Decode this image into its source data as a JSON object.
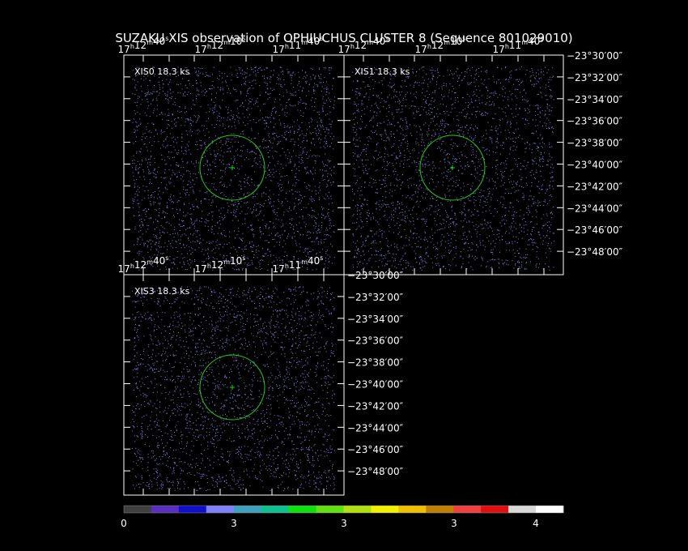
{
  "title": "SUZAKU XIS observation of OPHIUCHUS CLUSTER 8  (Sequence 801029010)",
  "colors": {
    "background": "#000000",
    "frame": "#ffffff",
    "region": "#22cc22",
    "events": "#8a88ee"
  },
  "panels": [
    {
      "id": "xis0",
      "label": "XIS0 18.3 ks",
      "ra_ticks": [
        {
          "h": "17",
          "m": "12",
          "s": "40"
        },
        {
          "h": "17",
          "m": "12",
          "s": "10"
        },
        {
          "h": "17",
          "m": "11",
          "s": "40"
        }
      ],
      "dec_ticks": []
    },
    {
      "id": "xis1",
      "label": "XIS1 18.3 ks",
      "ra_ticks": [
        {
          "h": "17",
          "m": "12",
          "s": "40"
        },
        {
          "h": "17",
          "m": "12",
          "s": "10"
        },
        {
          "h": "17",
          "m": "11",
          "s": "40"
        }
      ],
      "dec_ticks": [
        "−23°30′00″",
        "−23°32′00″",
        "−23°34′00″",
        "−23°36′00″",
        "−23°38′00″",
        "−23°40′00″",
        "−23°42′00″",
        "−23°44′00″",
        "−23°46′00″",
        "−23°48′00″"
      ]
    },
    {
      "id": "xis3",
      "label": "XIS3 18.3 ks",
      "ra_ticks": [
        {
          "h": "17",
          "m": "12",
          "s": "40"
        },
        {
          "h": "17",
          "m": "12",
          "s": "10"
        },
        {
          "h": "17",
          "m": "11",
          "s": "40"
        }
      ],
      "dec_ticks": [
        "−23°30′00″",
        "−23°32′00″",
        "−23°34′00″",
        "−23°36′00″",
        "−23°38′00″",
        "−23°40′00″",
        "−23°42′00″",
        "−23°44′00″",
        "−23°46′00″",
        "−23°48′00″"
      ]
    }
  ],
  "colorbar": {
    "colors": [
      "#404040",
      "#5a2fbf",
      "#1010cc",
      "#8080ff",
      "#40a0c0",
      "#10c090",
      "#10e010",
      "#60e010",
      "#b0e010",
      "#f0f000",
      "#f0c000",
      "#c08000",
      "#f04040",
      "#e01010",
      "#d8d8d8",
      "#ffffff"
    ],
    "labels": [
      "0",
      "3",
      "3",
      "3",
      "4"
    ]
  }
}
